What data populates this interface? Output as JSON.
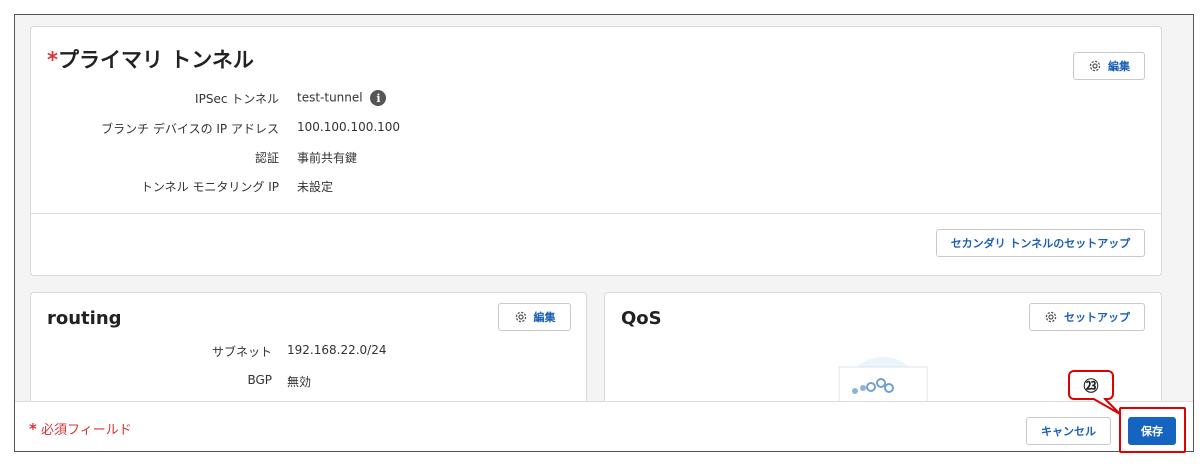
{
  "primary": {
    "required_mark": "*",
    "title": "プライマリ トンネル",
    "edit_label": "編集",
    "fields": [
      {
        "key": "IPSec トンネル",
        "value": "test-tunnel"
      },
      {
        "key": "ブランチ デバイスの IP アドレス",
        "value": "100.100.100.100"
      },
      {
        "key": "認証",
        "value": "事前共有鍵"
      },
      {
        "key": "トンネル モニタリング IP",
        "value": "未設定"
      }
    ],
    "info_icon": "i",
    "secondary_setup_label": "セカンダリ トンネルのセットアップ"
  },
  "routing": {
    "title": "routing",
    "edit_label": "編集",
    "fields": [
      {
        "key": "サブネット",
        "value": "192.168.22.0/24"
      },
      {
        "key": "BGP",
        "value": "無効"
      }
    ]
  },
  "qos": {
    "title": "QoS",
    "setup_label": "セットアップ"
  },
  "footer": {
    "required_star": "*",
    "required_text": "必須フィールド",
    "cancel_label": "キャンセル",
    "save_label": "保存"
  },
  "annotation": {
    "step_number": "㉓"
  },
  "colors": {
    "accent": "#1565c0",
    "link": "#1a5fb4",
    "required": "#dd3333",
    "highlight": "#e00000"
  },
  "icons": {
    "gear": "gear-icon",
    "info": "info-icon"
  }
}
